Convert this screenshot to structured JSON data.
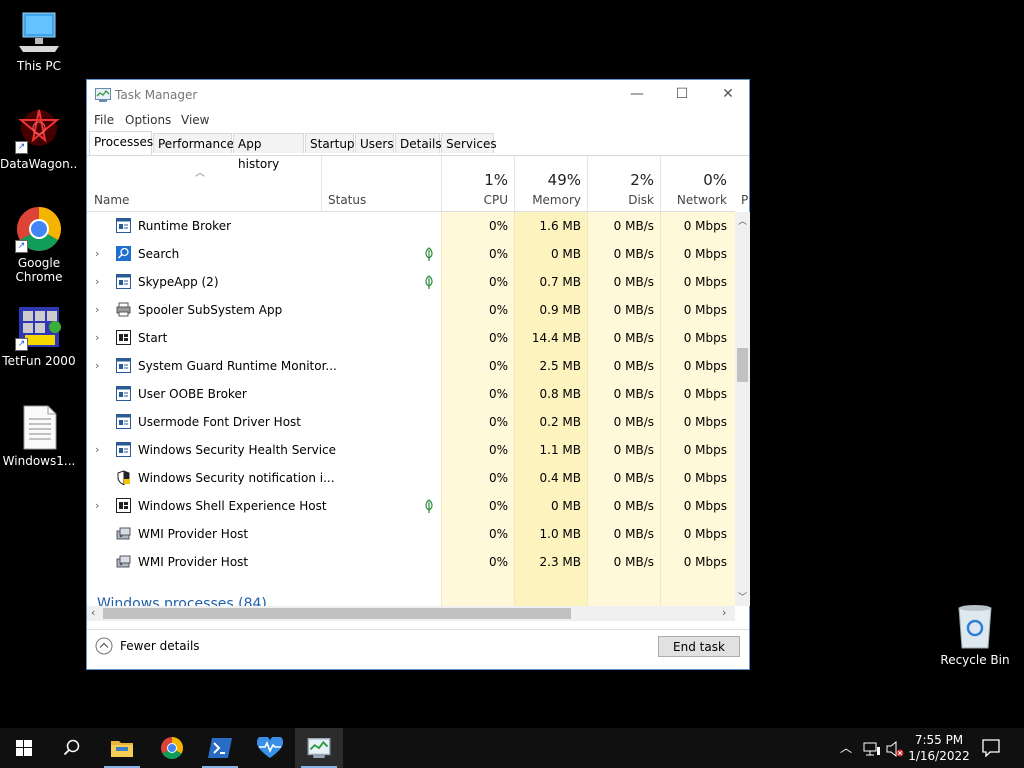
{
  "desktop": {
    "icons": [
      {
        "label": "This PC"
      },
      {
        "label": "DataWagon..."
      },
      {
        "label": "Google Chrome"
      },
      {
        "label": "TetFun 2000"
      },
      {
        "label": "Windows1..."
      },
      {
        "label": "Recycle Bin"
      }
    ]
  },
  "window": {
    "title": "Task Manager",
    "menu": [
      "File",
      "Options",
      "View"
    ],
    "tabs": [
      "Processes",
      "Performance",
      "App history",
      "Startup",
      "Users",
      "Details",
      "Services"
    ],
    "columns": {
      "name": "Name",
      "status": "Status",
      "cpu": {
        "pct": "1%",
        "label": "CPU"
      },
      "memory": {
        "pct": "49%",
        "label": "Memory"
      },
      "disk": {
        "pct": "2%",
        "label": "Disk"
      },
      "network": {
        "pct": "0%",
        "label": "Network"
      },
      "power": "P"
    },
    "rows": [
      {
        "name": "Runtime Broker",
        "expand": false,
        "suspended": false,
        "cpu": "0%",
        "memory": "1.6 MB",
        "disk": "0 MB/s",
        "network": "0 Mbps"
      },
      {
        "name": "Search",
        "expand": true,
        "suspended": true,
        "cpu": "0%",
        "memory": "0 MB",
        "disk": "0 MB/s",
        "network": "0 Mbps"
      },
      {
        "name": "SkypeApp (2)",
        "expand": true,
        "suspended": true,
        "cpu": "0%",
        "memory": "0.7 MB",
        "disk": "0 MB/s",
        "network": "0 Mbps"
      },
      {
        "name": "Spooler SubSystem App",
        "expand": true,
        "suspended": false,
        "cpu": "0%",
        "memory": "0.9 MB",
        "disk": "0 MB/s",
        "network": "0 Mbps"
      },
      {
        "name": "Start",
        "expand": true,
        "suspended": false,
        "cpu": "0%",
        "memory": "14.4 MB",
        "disk": "0 MB/s",
        "network": "0 Mbps"
      },
      {
        "name": "System Guard Runtime Monitor...",
        "expand": true,
        "suspended": false,
        "cpu": "0%",
        "memory": "2.5 MB",
        "disk": "0 MB/s",
        "network": "0 Mbps"
      },
      {
        "name": "User OOBE Broker",
        "expand": false,
        "suspended": false,
        "cpu": "0%",
        "memory": "0.8 MB",
        "disk": "0 MB/s",
        "network": "0 Mbps"
      },
      {
        "name": "Usermode Font Driver Host",
        "expand": false,
        "suspended": false,
        "cpu": "0%",
        "memory": "0.2 MB",
        "disk": "0 MB/s",
        "network": "0 Mbps"
      },
      {
        "name": "Windows Security Health Service",
        "expand": true,
        "suspended": false,
        "cpu": "0%",
        "memory": "1.1 MB",
        "disk": "0 MB/s",
        "network": "0 Mbps"
      },
      {
        "name": "Windows Security notification i...",
        "expand": false,
        "suspended": false,
        "cpu": "0%",
        "memory": "0.4 MB",
        "disk": "0 MB/s",
        "network": "0 Mbps"
      },
      {
        "name": "Windows Shell Experience Host",
        "expand": true,
        "suspended": true,
        "cpu": "0%",
        "memory": "0 MB",
        "disk": "0 MB/s",
        "network": "0 Mbps"
      },
      {
        "name": "WMI Provider Host",
        "expand": false,
        "suspended": false,
        "cpu": "0%",
        "memory": "1.0 MB",
        "disk": "0 MB/s",
        "network": "0 Mbps"
      },
      {
        "name": "WMI Provider Host",
        "expand": false,
        "suspended": false,
        "cpu": "0%",
        "memory": "2.3 MB",
        "disk": "0 MB/s",
        "network": "0 Mbps"
      }
    ],
    "section_header": "Windows processes (84)",
    "fewer_details": "Fewer details",
    "end_task": "End task"
  },
  "taskbar": {
    "time": "7:55 PM",
    "date": "1/16/2022"
  },
  "colors": {
    "heat_light": "#fff9d9",
    "heat_mid": "#fdf3bf",
    "accent": "#1f5fa8"
  }
}
